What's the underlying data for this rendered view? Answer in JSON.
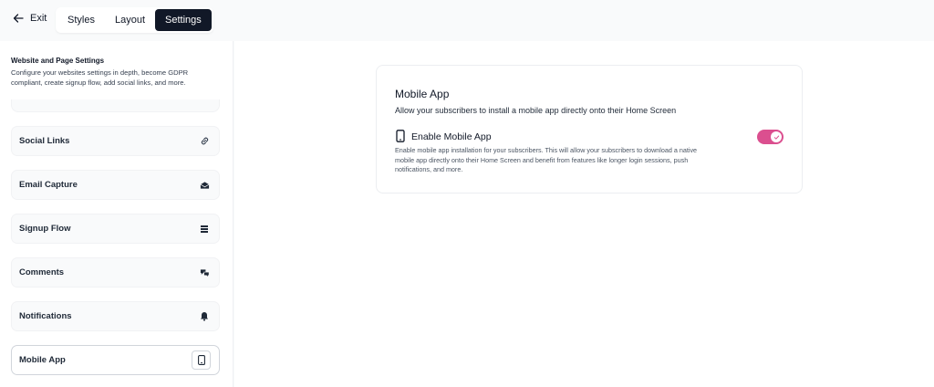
{
  "topbar": {
    "exit_label": "Exit",
    "tabs": [
      {
        "label": "Styles",
        "active": false
      },
      {
        "label": "Layout",
        "active": false
      },
      {
        "label": "Settings",
        "active": true
      }
    ]
  },
  "sidebar": {
    "title": "Website and Page Settings",
    "description": "Configure your websites settings in depth, become GDPR compliant, create signup flow, add social links, and more.",
    "items": [
      {
        "label": "Social Links",
        "icon": "link-icon"
      },
      {
        "label": "Email Capture",
        "icon": "envelope-icon"
      },
      {
        "label": "Signup Flow",
        "icon": "stack-icon"
      },
      {
        "label": "Comments",
        "icon": "chat-bubbles-icon"
      },
      {
        "label": "Notifications",
        "icon": "bell-icon"
      },
      {
        "label": "Mobile App",
        "icon": "phone-icon",
        "active": true
      }
    ]
  },
  "main": {
    "card": {
      "title": "Mobile App",
      "subtitle": "Allow your subscribers to install a mobile app directly onto their Home Screen",
      "option": {
        "title": "Enable Mobile App",
        "description": "Enable mobile app installation for your subscribers. This will allow your subscribers to download a native mobile app directly onto their Home Screen and benefit from features like longer login sessions, push notifications, and more.",
        "enabled": true
      }
    }
  },
  "colors": {
    "accent_toggle": "#db4f8f",
    "active_tab_bg": "#111827"
  }
}
